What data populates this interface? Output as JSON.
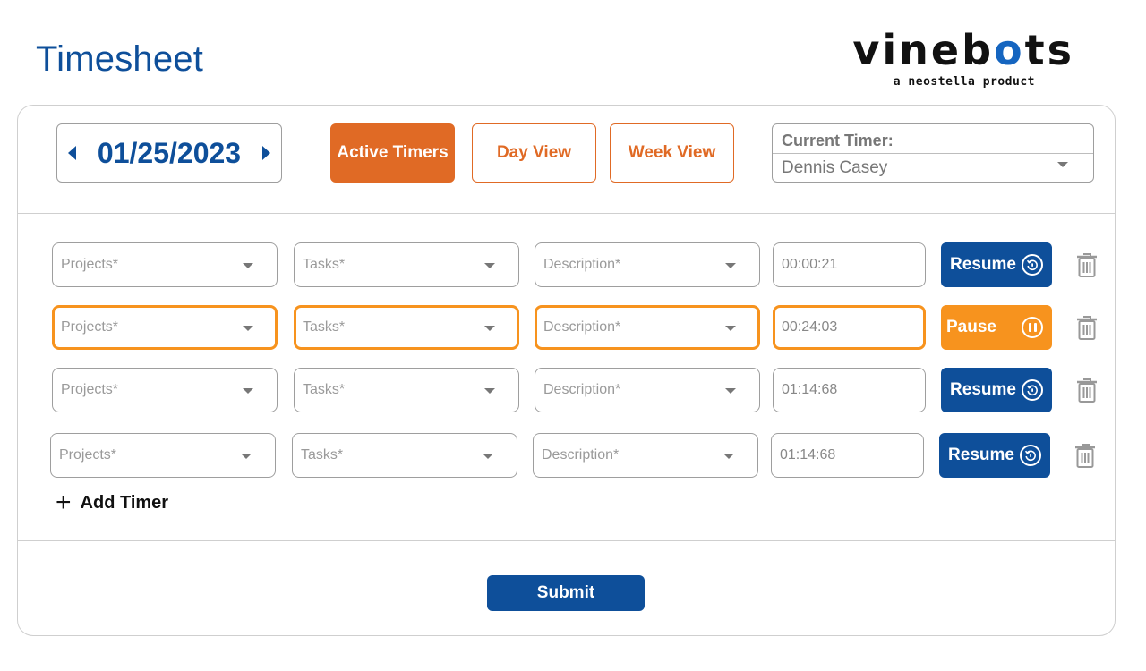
{
  "page": {
    "title": "Timesheet"
  },
  "brand": {
    "name": "vinebots",
    "tagline": "a neostella product"
  },
  "date_nav": {
    "date": "01/25/2023"
  },
  "views": {
    "active_label": "Active Timers",
    "day_label": "Day View",
    "week_label": "Week View"
  },
  "current_timer": {
    "label": "Current Timer:",
    "value": "Dennis Casey"
  },
  "rows": [
    {
      "projects": "Projects*",
      "tasks": "Tasks*",
      "description": "Description*",
      "time": "00:00:21",
      "action": "Resume",
      "state": "stopped"
    },
    {
      "projects": "Projects*",
      "tasks": "Tasks*",
      "description": "Description*",
      "time": "00:24:03",
      "action": "Pause",
      "state": "running"
    },
    {
      "projects": "Projects*",
      "tasks": "Tasks*",
      "description": "Description*",
      "time": "01:14:68",
      "action": "Resume",
      "state": "stopped"
    },
    {
      "projects": "Projects*",
      "tasks": "Tasks*",
      "description": "Description*",
      "time": "01:14:68",
      "action": "Resume",
      "state": "stopped"
    }
  ],
  "add_timer": {
    "label": "Add Timer"
  },
  "submit": {
    "label": "Submit"
  },
  "colors": {
    "primary": "#0e4f9a",
    "accent_orange": "#e06a25",
    "highlight": "#f7931e"
  },
  "icons": [
    "chevron-left-icon",
    "chevron-right-icon",
    "dropdown-caret-icon",
    "resume-icon",
    "pause-icon",
    "trash-icon",
    "plus-icon"
  ]
}
